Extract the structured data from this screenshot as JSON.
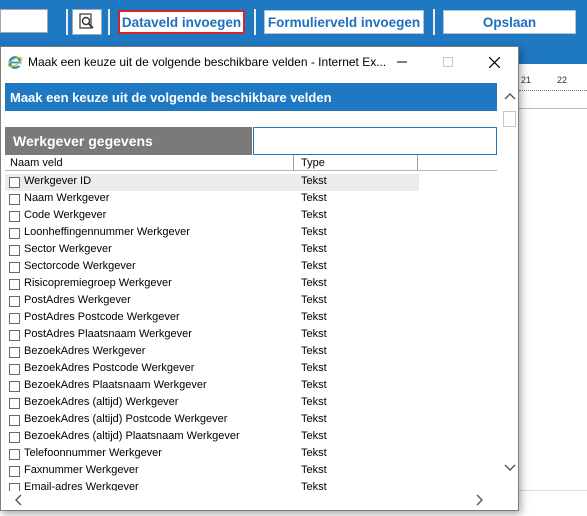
{
  "toolbar": {
    "insert_data_field": "Dataveld invoegen",
    "insert_form_field": "Formulierveld invoegen",
    "save": "Opslaan"
  },
  "ruler": {
    "mark1": "21",
    "mark2": "22"
  },
  "dialog": {
    "title": "Maak een keuze uit de volgende beschikbare velden - Internet Ex...",
    "header": "Maak een keuze uit de volgende beschikbare velden",
    "group_title": "Werkgever gegevens",
    "col_name": "Naam veld",
    "col_type": "Type",
    "rows": [
      {
        "name": "Werkgever ID",
        "type": "Tekst"
      },
      {
        "name": "Naam Werkgever",
        "type": "Tekst"
      },
      {
        "name": "Code Werkgever",
        "type": "Tekst"
      },
      {
        "name": "Loonheffingennummer Werkgever",
        "type": "Tekst"
      },
      {
        "name": "Sector Werkgever",
        "type": "Tekst"
      },
      {
        "name": "Sectorcode Werkgever",
        "type": "Tekst"
      },
      {
        "name": "Risicopremiegroep Werkgever",
        "type": "Tekst"
      },
      {
        "name": "PostAdres Werkgever",
        "type": "Tekst"
      },
      {
        "name": "PostAdres Postcode Werkgever",
        "type": "Tekst"
      },
      {
        "name": "PostAdres Plaatsnaam Werkgever",
        "type": "Tekst"
      },
      {
        "name": "BezoekAdres Werkgever",
        "type": "Tekst"
      },
      {
        "name": "BezoekAdres Postcode Werkgever",
        "type": "Tekst"
      },
      {
        "name": "BezoekAdres Plaatsnaam Werkgever",
        "type": "Tekst"
      },
      {
        "name": "BezoekAdres (altijd) Werkgever",
        "type": "Tekst"
      },
      {
        "name": "BezoekAdres (altijd) Postcode Werkgever",
        "type": "Tekst"
      },
      {
        "name": "BezoekAdres (altijd) Plaatsnaam Werkgever",
        "type": "Tekst"
      },
      {
        "name": "Telefoonnummer Werkgever",
        "type": "Tekst"
      },
      {
        "name": "Faxnummer Werkgever",
        "type": "Tekst"
      },
      {
        "name": "Email-adres Werkgever",
        "type": "Tekst"
      }
    ]
  },
  "colors": {
    "accent_blue": "#1f78c2",
    "selected_border": "#d2252c",
    "group_gray": "#7a7a7a"
  },
  "icons": {
    "preview": "magnifier-document-icon",
    "browser": "internet-explorer-icon"
  }
}
